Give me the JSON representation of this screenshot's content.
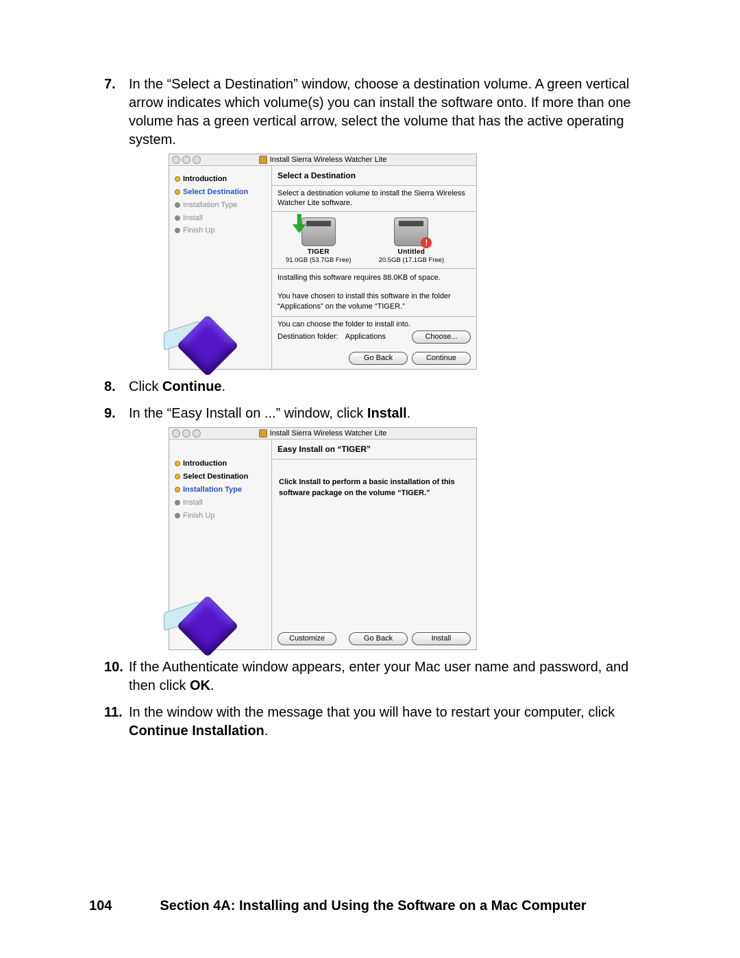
{
  "steps": [
    {
      "n": "7.",
      "text": "In the “Select a Destination” window, choose a destination volume. A green vertical arrow indicates which volume(s) you can install the software onto. If more than one volume has a green vertical arrow, select the volume that has the active operating system."
    },
    {
      "n": "8.",
      "pre": "Click ",
      "bold": "Continue",
      "post": "."
    },
    {
      "n": "9.",
      "pre": "In the “Easy Install on ...” window, click ",
      "bold": "Install",
      "post": "."
    },
    {
      "n": "10.",
      "pre": "If the Authenticate window appears, enter your Mac user name and password, and then click ",
      "bold": "OK",
      "post": "."
    },
    {
      "n": "11.",
      "pre": "In the window with the message that you will have to restart your computer, click ",
      "bold": "Continue Installation",
      "post": "."
    }
  ],
  "shot1": {
    "title": "Install Sierra Wireless Watcher Lite",
    "heading": "Select a Destination",
    "prompt": "Select a destination volume to install the Sierra Wireless Watcher Lite software.",
    "sidebar": [
      "Introduction",
      "Select Destination",
      "Installation Type",
      "Install",
      "Finish Up"
    ],
    "vols": [
      {
        "name": "TIGER",
        "size": "91.0GB (53.7GB Free)"
      },
      {
        "name": "Untitled",
        "size": "20.5GB (17.1GB Free)"
      }
    ],
    "req": "Installing this software requires 88.0KB of space.",
    "msg": "You have chosen to install this software in the folder “Applications” on the volume “TIGER.”",
    "can": "You can choose the folder to install into.",
    "destlabel": "Destination folder:",
    "destval": "Applications",
    "choose": "Choose...",
    "back": "Go Back",
    "cont": "Continue"
  },
  "shot2": {
    "title": "Install Sierra Wireless Watcher Lite",
    "heading": "Easy Install on “TIGER”",
    "sidebar": [
      "Introduction",
      "Select Destination",
      "Installation Type",
      "Install",
      "Finish Up"
    ],
    "body": "Click Install to perform a basic installation of this software package on the volume “TIGER.”",
    "customize": "Customize",
    "back": "Go Back",
    "install": "Install"
  },
  "footer": {
    "page": "104",
    "text": "Section 4A: Installing and Using the Software on a Mac Computer"
  }
}
